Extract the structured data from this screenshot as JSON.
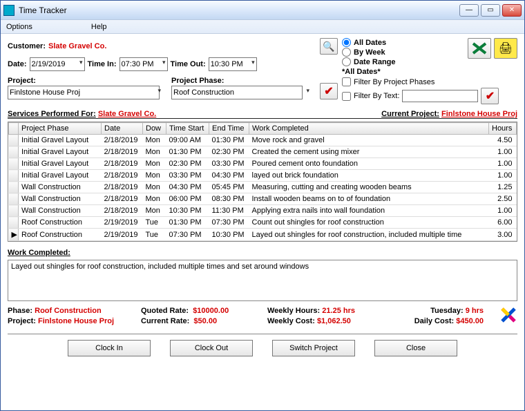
{
  "window": {
    "title": "Time Tracker"
  },
  "menu": {
    "options": "Options",
    "help": "Help"
  },
  "top": {
    "customer_label": "Customer:",
    "customer_value": "Slate Gravel Co.",
    "date_label": "Date:",
    "date_value": "2/19/2019",
    "timein_label": "Time In:",
    "timein_value": "07:30 PM",
    "timeout_label": "Time Out:",
    "timeout_value": "10:30 PM",
    "project_label": "Project:",
    "project_value": "Finlstone House Proj",
    "phase_label": "Project Phase:",
    "phase_value": "Roof Construction"
  },
  "filter": {
    "all_dates": "All Dates",
    "by_week": "By Week",
    "date_range": "Date Range",
    "all_dates_star": "*All Dates*",
    "by_phases": "Filter By Project Phases",
    "by_text": "Filter By Text:",
    "text_value": ""
  },
  "mid_header": {
    "services_for": "Services Performed For:",
    "services_val": "Slate Gravel Co.",
    "current_proj": "Current Project:",
    "current_val": "Finlstone House Proj"
  },
  "columns": {
    "phase": "Project Phase",
    "date": "Date",
    "dow": "Dow",
    "start": "Time Start",
    "end": "End Time",
    "work": "Work Completed",
    "hours": "Hours"
  },
  "rows": [
    {
      "phase": "Initial Gravel Layout",
      "date": "2/18/2019",
      "dow": "Mon",
      "start": "09:00 AM",
      "end": "01:30 PM",
      "work": "Move rock and gravel",
      "hours": "4.50",
      "marker": ""
    },
    {
      "phase": "Initial Gravel Layout",
      "date": "2/18/2019",
      "dow": "Mon",
      "start": "01:30 PM",
      "end": "02:30 PM",
      "work": "Created the cement using mixer",
      "hours": "1.00",
      "marker": ""
    },
    {
      "phase": "Initial Gravel Layout",
      "date": "2/18/2019",
      "dow": "Mon",
      "start": "02:30 PM",
      "end": "03:30 PM",
      "work": "Poured cement onto foundation",
      "hours": "1.00",
      "marker": ""
    },
    {
      "phase": "Initial Gravel Layout",
      "date": "2/18/2019",
      "dow": "Mon",
      "start": "03:30 PM",
      "end": "04:30 PM",
      "work": "layed out brick foundation",
      "hours": "1.00",
      "marker": ""
    },
    {
      "phase": "Wall Construction",
      "date": "2/18/2019",
      "dow": "Mon",
      "start": "04:30 PM",
      "end": "05:45 PM",
      "work": "Measuring, cutting and creating wooden beams",
      "hours": "1.25",
      "marker": ""
    },
    {
      "phase": "Wall Construction",
      "date": "2/18/2019",
      "dow": "Mon",
      "start": "06:00 PM",
      "end": "08:30 PM",
      "work": "Install wooden beams on to of foundation",
      "hours": "2.50",
      "marker": ""
    },
    {
      "phase": "Wall Construction",
      "date": "2/18/2019",
      "dow": "Mon",
      "start": "10:30 PM",
      "end": "11:30 PM",
      "work": "Applying extra nails into wall foundation",
      "hours": "1.00",
      "marker": ""
    },
    {
      "phase": "Roof Construction",
      "date": "2/19/2019",
      "dow": "Tue",
      "start": "01:30 PM",
      "end": "07:30 PM",
      "work": "Count out shingles for roof construction",
      "hours": "6.00",
      "marker": ""
    },
    {
      "phase": "Roof Construction",
      "date": "2/19/2019",
      "dow": "Tue",
      "start": "07:30 PM",
      "end": "10:30 PM",
      "work": "Layed out shingles for roof construction, included multiple time",
      "hours": "3.00",
      "marker": "▶"
    }
  ],
  "wc": {
    "label": "Work Completed:",
    "text": "Layed out shingles for roof construction, included multiple times and set around windows"
  },
  "summary": {
    "phase_l": "Phase:",
    "phase_v": "Roof Construction",
    "project_l": "Project:",
    "project_v": "Finlstone House Proj",
    "quoted_l": "Quoted Rate:",
    "quoted_v": "$10000.00",
    "current_l": "Current Rate:",
    "current_v": "$50.00",
    "whours_l": "Weekly Hours:",
    "whours_v": "21.25 hrs",
    "wcost_l": "Weekly Cost:",
    "wcost_v": "$1,062.50",
    "day_l": "Tuesday:",
    "day_v": "9 hrs",
    "dcost_l": "Daily Cost:",
    "dcost_v": "$450.00"
  },
  "buttons": {
    "clockin": "Clock In",
    "clockout": "Clock Out",
    "switch": "Switch Project",
    "close": "Close"
  }
}
